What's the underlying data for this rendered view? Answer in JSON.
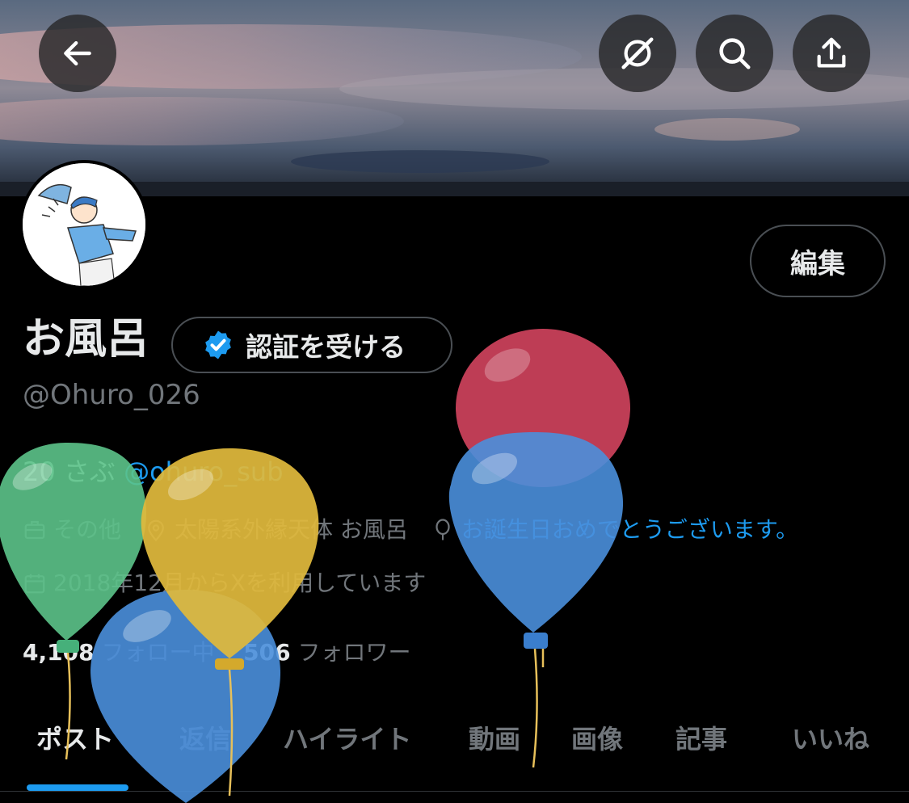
{
  "header": {
    "back_icon": "arrow-left-icon",
    "actions": [
      "grok-icon",
      "search-icon",
      "share-icon"
    ]
  },
  "profile": {
    "name": "お風呂",
    "handle": "@Ohuro_026",
    "edit_label": "編集",
    "verify_label": "認証を受ける",
    "bio_prefix": "20 さぶ ",
    "bio_mention": "@ohuro_sub",
    "category": "その他",
    "location": "太陽系外縁天体 お風呂",
    "birthday_text": "お誕生日おめでとうございます。",
    "joined": "2018年12月からXを利用しています",
    "following_count": "4,108",
    "following_label": "フォロー中",
    "followers_count": "506",
    "followers_label": "フォロワー"
  },
  "tabs": [
    {
      "label": "ポスト",
      "active": true
    },
    {
      "label": "返信",
      "active": false
    },
    {
      "label": "ハイライト",
      "active": false
    },
    {
      "label": "動画",
      "active": false
    },
    {
      "label": "画像",
      "active": false
    },
    {
      "label": "記事",
      "active": false
    },
    {
      "label": "いいね",
      "active": false
    }
  ],
  "colors": {
    "accent": "#1d9bf0",
    "text_primary": "#e7e9ea",
    "text_secondary": "#71767b",
    "balloon_red": "#c8405a",
    "balloon_blue": "#4a8fdc",
    "balloon_green": "#5cc38a",
    "balloon_yellow": "#e0b93c"
  }
}
